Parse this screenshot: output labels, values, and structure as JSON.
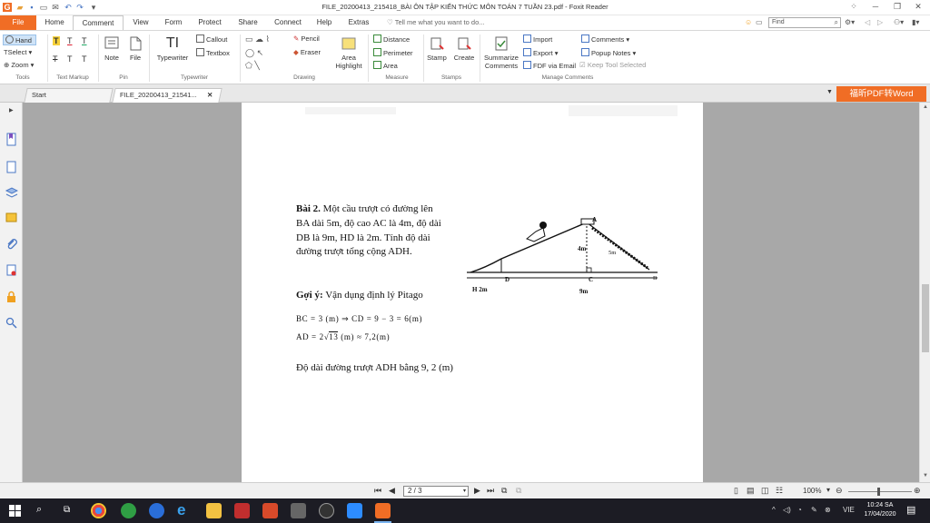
{
  "window": {
    "title": "FILE_20200413_215418_BÀI ÔN TẬP KIẾN THỨC MÔN TOÁN 7 TUẦN 23.pdf - Foxit Reader"
  },
  "tabs": [
    "File",
    "Home",
    "Comment",
    "View",
    "Form",
    "Protect",
    "Share",
    "Connect",
    "Help",
    "Extras"
  ],
  "active_tab": "Comment",
  "tell_me": "Tell me what you want to do...",
  "find_placeholder": "Find",
  "ribbon": {
    "tools": {
      "hand": "Hand",
      "select": "Select",
      "zoom": "Zoom",
      "label": "Tools"
    },
    "text_markup": {
      "label": "Text Markup"
    },
    "pin": {
      "note": "Note",
      "file": "File",
      "label": "Pin"
    },
    "typewriter": {
      "typewriter": "Typewriter",
      "callout": "Callout",
      "textbox": "Textbox",
      "label": "Typewriter"
    },
    "drawing": {
      "pencil": "Pencil",
      "eraser": "Eraser",
      "area_highlight": "Area Highlight",
      "label": "Drawing"
    },
    "measure": {
      "distance": "Distance",
      "perimeter": "Perimeter",
      "area": "Area",
      "label": "Measure"
    },
    "stamps": {
      "stamp": "Stamp",
      "create": "Create",
      "label": "Stamps"
    },
    "manage": {
      "summarize": "Summarize Comments",
      "import": "Import",
      "export": "Export",
      "fdf_email": "FDF via Email",
      "comments": "Comments",
      "popup_notes": "Popup Notes",
      "keep_tool": "Keep Tool Selected",
      "label": "Manage Comments"
    }
  },
  "doc_tabs": [
    {
      "label": "Start"
    },
    {
      "label": "FILE_20200413_21541..."
    }
  ],
  "promo_label": "福昕PDF转Word",
  "document": {
    "problem_title": "Bài 2.",
    "problem_line1": "Một cầu trượt có đường lên",
    "problem_line2": "BA dài 5m, độ cao AC là 4m, độ dài",
    "problem_line3": "DB là 9m, HD là 2m. Tính độ dài",
    "problem_line4": "đường trượt tổng cộng ADH.",
    "hint_title": "Gợi ý:",
    "hint_text": "Vận dụng định lý Pitago",
    "calc1": "BC = 3 (m) ⇒ CD = 9 − 3 = 6(m)",
    "calc2_a": "AD = 2",
    "calc2_root": "13",
    "calc2_b": "(m) ≈ 7,2(m)",
    "answer": "Độ dài đường trượt ADH  bằng  9, 2 (m)",
    "figure": {
      "label_a": "A",
      "label_4m": "4m",
      "label_5m": "5m",
      "label_d": "D",
      "label_c": "C",
      "label_b": "B",
      "label_h2m": "H  2m",
      "label_9m": "9m"
    }
  },
  "status": {
    "page_value": "2 / 3",
    "zoom": "100%"
  },
  "taskbar": {
    "time": "10:24 SA",
    "date": "17/04/2020",
    "lang": "VIE"
  }
}
